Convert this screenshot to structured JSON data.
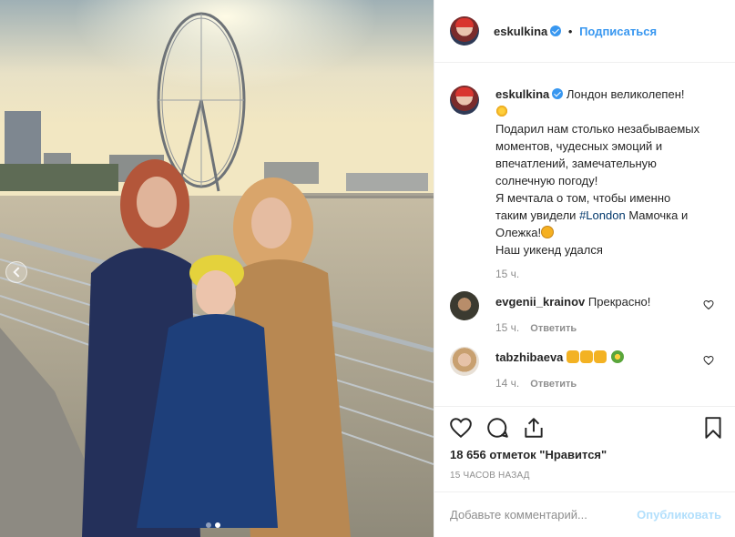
{
  "post": {
    "header": {
      "username": "eskulkina",
      "separator": "•",
      "follow_label": "Подписаться"
    },
    "caption": {
      "username": "eskulkina",
      "lines": [
        "Лондон великолепен!",
        "Подарил нам столько незабываемых",
        "моментов, чудесных эмоций и",
        "впечатлений, замечательную",
        "солнечную погоду!",
        "Я мечтала о том, чтобы именно",
        "таким увидели",
        "#London",
        "Мамочка и",
        "Олежка!",
        "Наш уикенд удался"
      ],
      "time": "15 ч."
    },
    "comments": [
      {
        "username": "evgenii_krainov",
        "text": "Прекрасно!",
        "time": "15 ч.",
        "reply_label": "Ответить"
      },
      {
        "username": "tabzhibaeva",
        "text": "",
        "time": "14 ч.",
        "reply_label": "Ответить"
      }
    ],
    "likes_text": "18 656 отметок \"Нравится\"",
    "posted_text": "15 ЧАСОВ НАЗАД",
    "add_comment": {
      "placeholder": "Добавьте комментарий...",
      "publish_label": "Опубликовать"
    },
    "carousel": {
      "total": 2,
      "active": 2
    }
  },
  "icons": [
    "heart-icon",
    "comment-icon",
    "share-icon",
    "bookmark-icon",
    "chevron-left-icon",
    "verified-icon"
  ],
  "colors": {
    "link": "#3897f0",
    "hashtag": "#00376b",
    "muted": "#8e8e8e",
    "publish_disabled": "#b2dffc",
    "border": "#efefef"
  }
}
